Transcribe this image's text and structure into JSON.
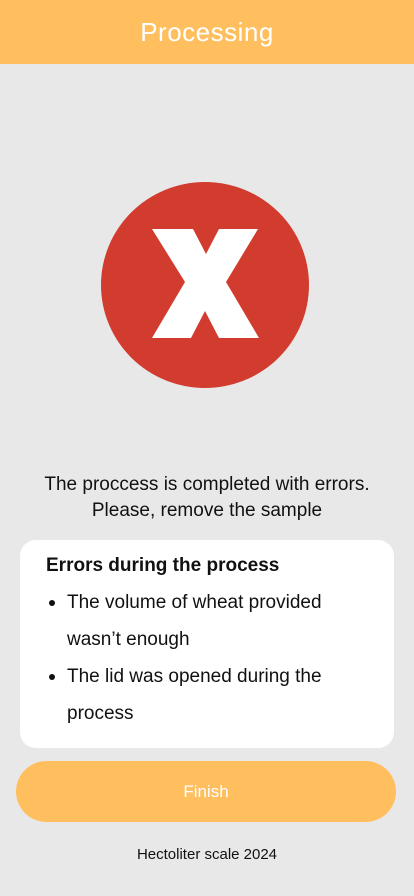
{
  "header": {
    "title": "Processing"
  },
  "status": {
    "icon": "error-x-icon",
    "line1": "The proccess is completed with errors.",
    "line2": "Please, remove the sample"
  },
  "errors_card": {
    "title": "Errors during the process",
    "items": [
      "The volume of wheat provided wasn’t enough",
      "The lid was opened during the process"
    ]
  },
  "finish_button": {
    "label": "Finish"
  },
  "footer": {
    "text": "Hectoliter scale 2024"
  },
  "colors": {
    "accent": "#ffbf5e",
    "error": "#d23c2f",
    "background": "#e8e8e8",
    "card": "#ffffff"
  }
}
